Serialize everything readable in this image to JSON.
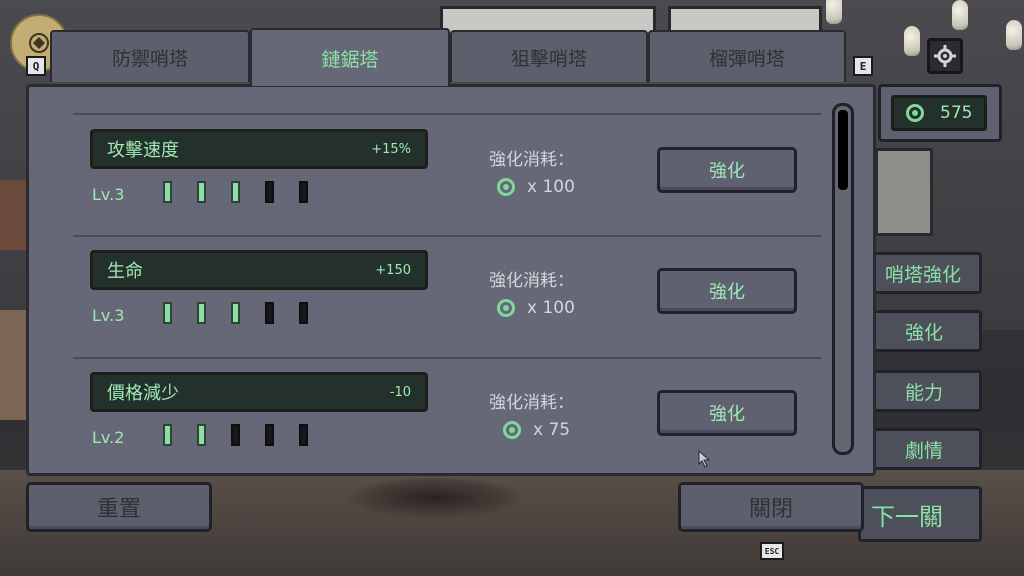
{
  "tabs": [
    {
      "label": "防禦哨塔",
      "active": false
    },
    {
      "label": "鏈鋸塔",
      "active": true
    },
    {
      "label": "狙擊哨塔",
      "active": false
    },
    {
      "label": "榴彈哨塔",
      "active": false
    }
  ],
  "tab_keys": {
    "left": "Q",
    "right": "E"
  },
  "upgrades": [
    {
      "name": "攻擊速度",
      "bonus": "+15%",
      "level": "Lv.3",
      "filled": 3,
      "max": 5,
      "cost_label": "強化消耗：",
      "cost": "x 100",
      "button": "強化"
    },
    {
      "name": "生命",
      "bonus": "+150",
      "level": "Lv.3",
      "filled": 3,
      "max": 5,
      "cost_label": "強化消耗：",
      "cost": "x 100",
      "button": "強化"
    },
    {
      "name": "價格減少",
      "bonus": "-10",
      "level": "Lv.2",
      "filled": 2,
      "max": 5,
      "cost_label": "強化消耗：",
      "cost": "x 75",
      "button": "強化"
    }
  ],
  "currency": {
    "amount": "575",
    "icon": "gem-icon",
    "color": "#7fd99d"
  },
  "side_menu": [
    "哨塔強化",
    "強化",
    "能力",
    "劇情"
  ],
  "bottom": {
    "reset": "重置",
    "close": "關閉",
    "next": "下一關",
    "esc_key": "ESC"
  },
  "icons": {
    "settings": "gear-icon",
    "emblem": "emblem-icon"
  },
  "colors": {
    "accent": "#8be0a5",
    "panel": "#666877",
    "dark": "#24302b"
  }
}
